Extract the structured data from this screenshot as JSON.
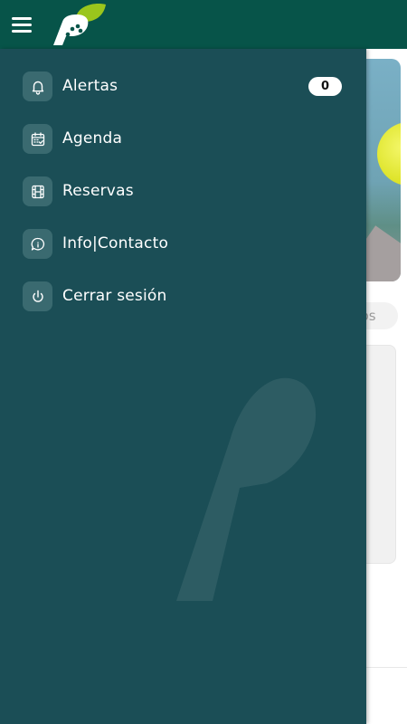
{
  "colors": {
    "topbar": "#075449",
    "drawer": "#1b4e56",
    "icon_box": "#3a6a70",
    "logo_green": "#9ac61c"
  },
  "header": {
    "menu_icon": "hamburger-menu-icon",
    "logo_icon": "padel-app-logo"
  },
  "drawer": {
    "items": [
      {
        "label": "Alertas",
        "icon": "bell-icon",
        "badge": "0"
      },
      {
        "label": "Agenda",
        "icon": "calendar-icon"
      },
      {
        "label": "Reservas",
        "icon": "film-icon"
      },
      {
        "label": "Info|Contacto",
        "icon": "chat-info-icon"
      },
      {
        "label": "Cerrar sesión",
        "icon": "power-icon"
      }
    ]
  },
  "background": {
    "chip_text": "dos"
  }
}
